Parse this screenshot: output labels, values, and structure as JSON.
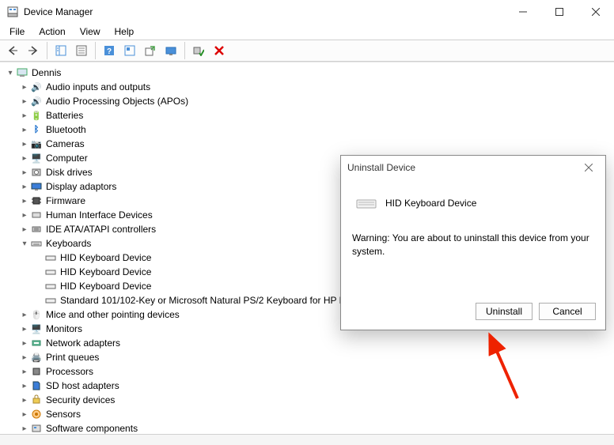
{
  "window": {
    "title": "Device Manager"
  },
  "menu": {
    "file": "File",
    "action": "Action",
    "view": "View",
    "help": "Help"
  },
  "tree": {
    "root": "Dennis",
    "audio_io": "Audio inputs and outputs",
    "audio_apo": "Audio Processing Objects (APOs)",
    "batteries": "Batteries",
    "bluetooth": "Bluetooth",
    "cameras": "Cameras",
    "computer": "Computer",
    "disk": "Disk drives",
    "display": "Display adaptors",
    "firmware": "Firmware",
    "hid": "Human Interface Devices",
    "ide": "IDE ATA/ATAPI controllers",
    "keyboards": "Keyboards",
    "kb_hid1": "HID Keyboard Device",
    "kb_hid2": "HID Keyboard Device",
    "kb_hid3": "HID Keyboard Device",
    "kb_std": "Standard 101/102-Key or Microsoft Natural PS/2 Keyboard for HP H",
    "mice": "Mice and other pointing devices",
    "monitors": "Monitors",
    "network": "Network adapters",
    "printq": "Print queues",
    "processors": "Processors",
    "sdhost": "SD host adapters",
    "security": "Security devices",
    "sensors": "Sensors",
    "software": "Software components"
  },
  "dialog": {
    "title": "Uninstall Device",
    "device_name": "HID Keyboard Device",
    "warning": "Warning: You are about to uninstall this device from your system.",
    "uninstall": "Uninstall",
    "cancel": "Cancel"
  }
}
